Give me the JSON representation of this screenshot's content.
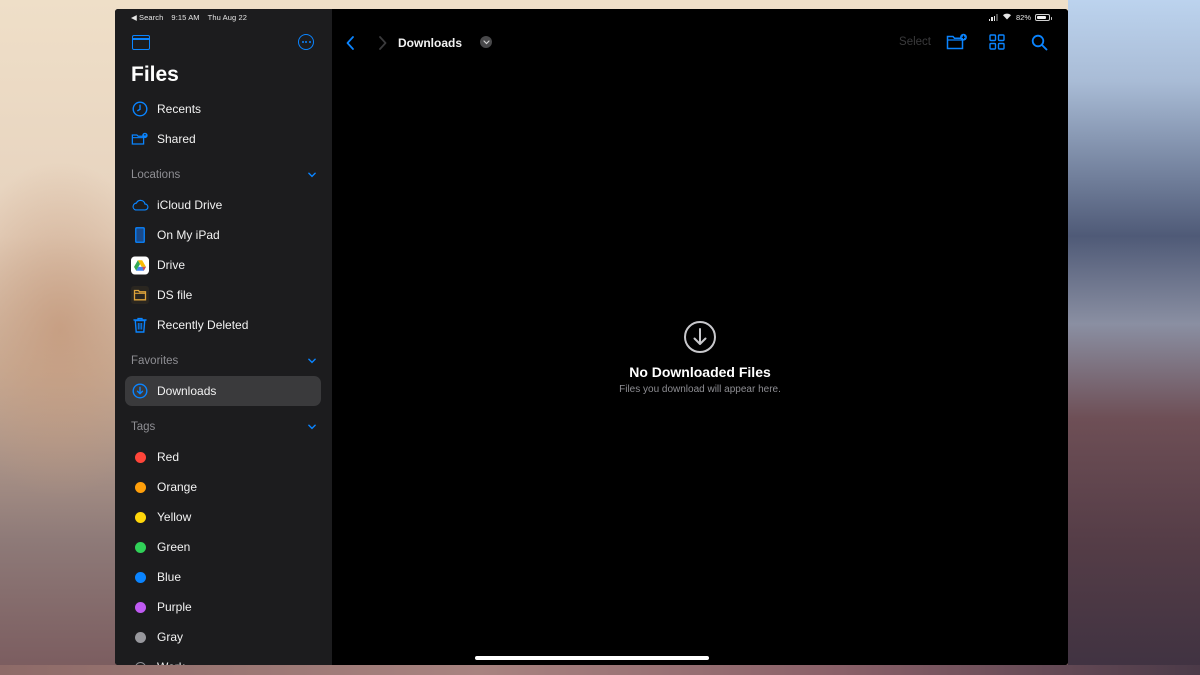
{
  "status_bar": {
    "back_app": "◀ Search",
    "time": "9:15 AM",
    "date": "Thu Aug 22",
    "battery": "82%",
    "battery_level": 0.82
  },
  "sidebar": {
    "title": "Files",
    "top_items": [
      {
        "label": "Recents",
        "icon": "clock-icon"
      },
      {
        "label": "Shared",
        "icon": "shared-folder-icon"
      }
    ],
    "sections": {
      "locations": {
        "label": "Locations",
        "items": [
          {
            "label": "iCloud Drive",
            "icon": "cloud-icon"
          },
          {
            "label": "On My iPad",
            "icon": "ipad-icon"
          },
          {
            "label": "Drive",
            "icon": "google-drive-icon"
          },
          {
            "label": "DS file",
            "icon": "folder-icon"
          },
          {
            "label": "Recently Deleted",
            "icon": "trash-icon"
          }
        ]
      },
      "favorites": {
        "label": "Favorites",
        "items": [
          {
            "label": "Downloads",
            "icon": "download-circle-icon",
            "selected": true
          }
        ]
      },
      "tags": {
        "label": "Tags",
        "items": [
          {
            "label": "Red",
            "color": "#ff453a"
          },
          {
            "label": "Orange",
            "color": "#ff9f0a"
          },
          {
            "label": "Yellow",
            "color": "#ffd60a"
          },
          {
            "label": "Green",
            "color": "#30d158"
          },
          {
            "label": "Blue",
            "color": "#0a84ff"
          },
          {
            "label": "Purple",
            "color": "#bf5af2"
          },
          {
            "label": "Gray",
            "color": "#98989d"
          },
          {
            "label": "Work",
            "color": "transparent"
          }
        ]
      }
    }
  },
  "toolbar": {
    "title": "Downloads",
    "select_label": "Select"
  },
  "empty_state": {
    "title": "No Downloaded Files",
    "subtitle": "Files you download will appear here."
  },
  "colors": {
    "accent": "#0a84ff",
    "sidebar_bg": "#1c1c1e",
    "selected_bg": "#3a3a3c",
    "main_bg": "#000000"
  }
}
